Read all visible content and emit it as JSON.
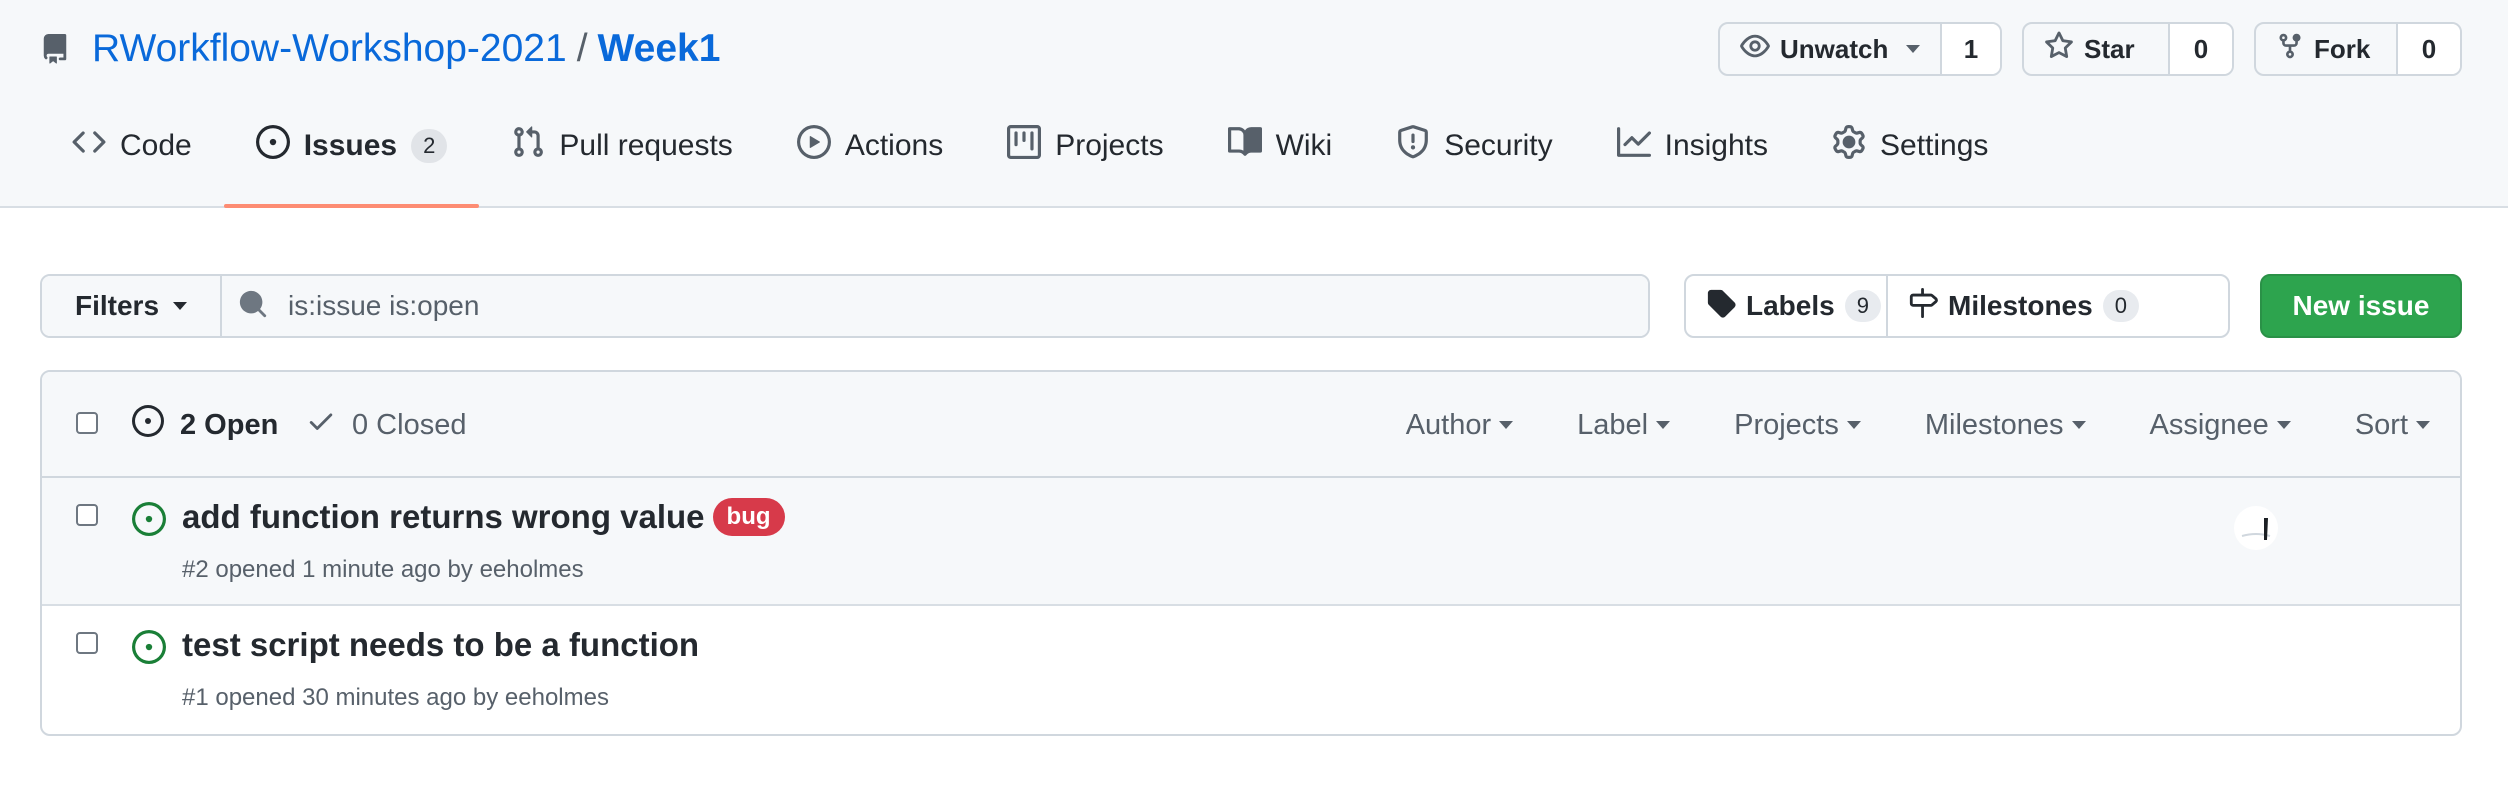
{
  "repo": {
    "owner": "RWorkflow-Workshop-2021",
    "separator": "/",
    "name": "Week1"
  },
  "actions": {
    "watch": {
      "label": "Unwatch",
      "count": "1"
    },
    "star": {
      "label": "Star",
      "count": "0"
    },
    "fork": {
      "label": "Fork",
      "count": "0"
    }
  },
  "tabs": [
    {
      "label": "Code",
      "icon": "code-icon"
    },
    {
      "label": "Issues",
      "icon": "issue-open-icon",
      "count": "2",
      "selected": true
    },
    {
      "label": "Pull requests",
      "icon": "pull-request-icon"
    },
    {
      "label": "Actions",
      "icon": "play-icon"
    },
    {
      "label": "Projects",
      "icon": "project-icon"
    },
    {
      "label": "Wiki",
      "icon": "book-icon"
    },
    {
      "label": "Security",
      "icon": "shield-icon"
    },
    {
      "label": "Insights",
      "icon": "graph-icon"
    },
    {
      "label": "Settings",
      "icon": "gear-icon"
    }
  ],
  "filterbar": {
    "filters_label": "Filters",
    "search_value": "is:issue is:open",
    "labels": {
      "label": "Labels",
      "count": "9"
    },
    "milestones": {
      "label": "Milestones",
      "count": "0"
    },
    "new_issue_label": "New issue"
  },
  "list_header": {
    "open_label": "2 Open",
    "closed_label": "0 Closed",
    "filters": [
      "Author",
      "Label",
      "Projects",
      "Milestones",
      "Assignee",
      "Sort"
    ]
  },
  "issues": [
    {
      "title": "add function returns wrong value",
      "label": "bug",
      "meta": "#2 opened 1 minute ago by eeholmes",
      "has_assignee": true
    },
    {
      "title": "test script needs to be a function",
      "meta": "#1 opened 30 minutes ago by eeholmes"
    }
  ],
  "colors": {
    "link": "#0969da",
    "primary_button": "#2da44e",
    "bug_label": "#d73a4a",
    "tab_underline": "#fd8c73",
    "open_icon": "#1a7f37"
  }
}
